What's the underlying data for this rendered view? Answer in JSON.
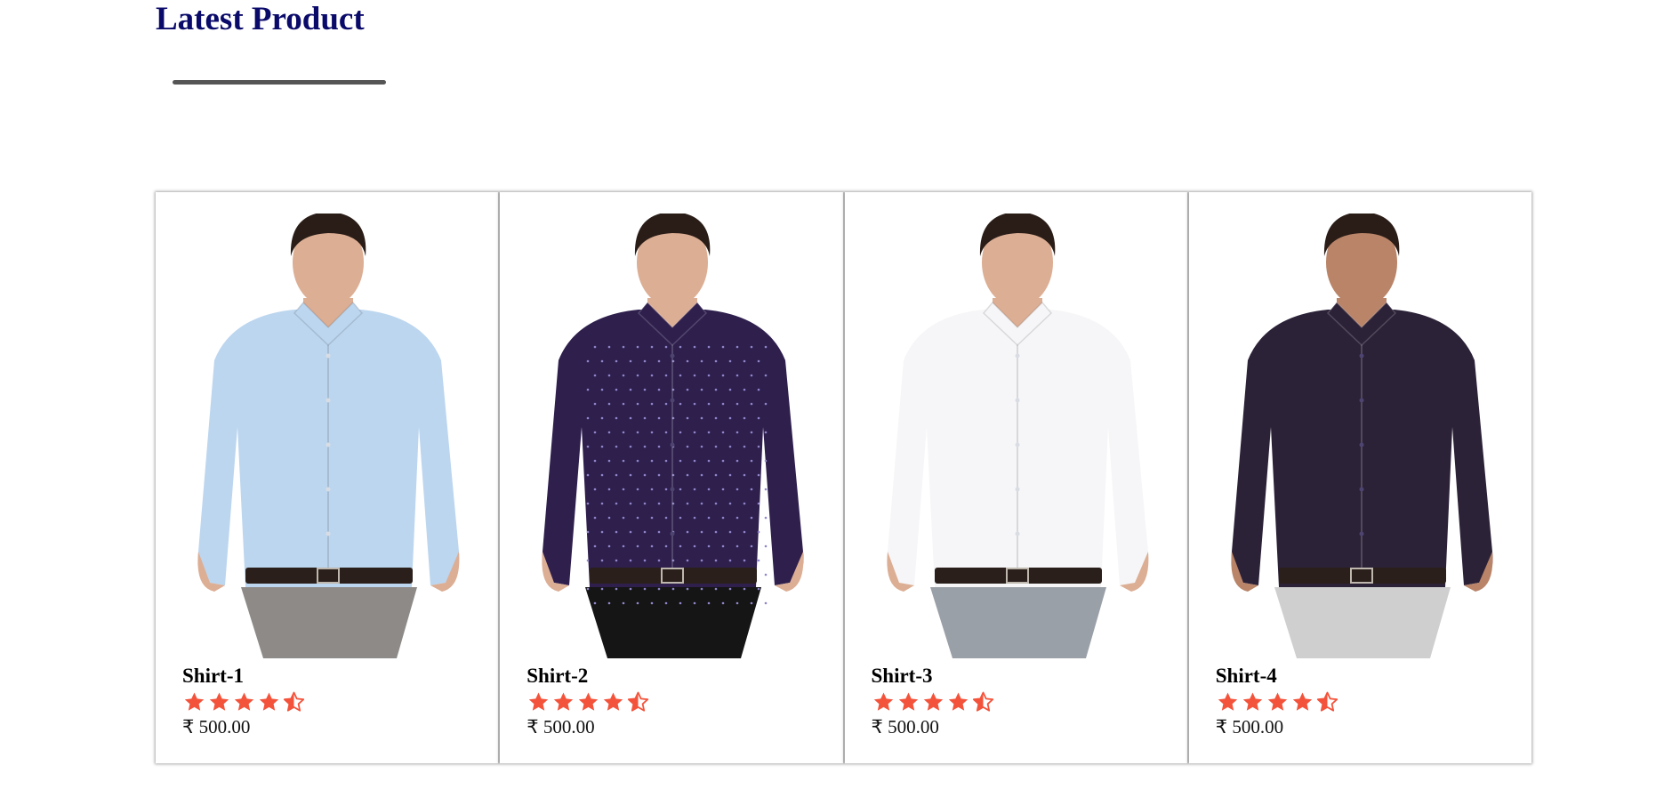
{
  "section": {
    "title": "Latest Product"
  },
  "colors": {
    "title": "#0a0a6a",
    "underline": "#555555",
    "star": "#f4533b",
    "text": "#000000"
  },
  "products": [
    {
      "name": "Shirt-1",
      "price": "₹ 500.00",
      "rating": 4.5,
      "image": "man-in-light-blue-shirt",
      "shirt_color": "#bcd6ef"
    },
    {
      "name": "Shirt-2",
      "price": "₹ 500.00",
      "rating": 4.5,
      "image": "man-in-dotted-purple-shirt",
      "shirt_color": "#2e1f4d"
    },
    {
      "name": "Shirt-3",
      "price": "₹ 500.00",
      "rating": 4.5,
      "image": "man-in-white-shirt",
      "shirt_color": "#f6f6f8"
    },
    {
      "name": "Shirt-4",
      "price": "₹ 500.00",
      "rating": 4.5,
      "image": "man-in-dark-purple-shirt",
      "shirt_color": "#2c2238"
    }
  ]
}
